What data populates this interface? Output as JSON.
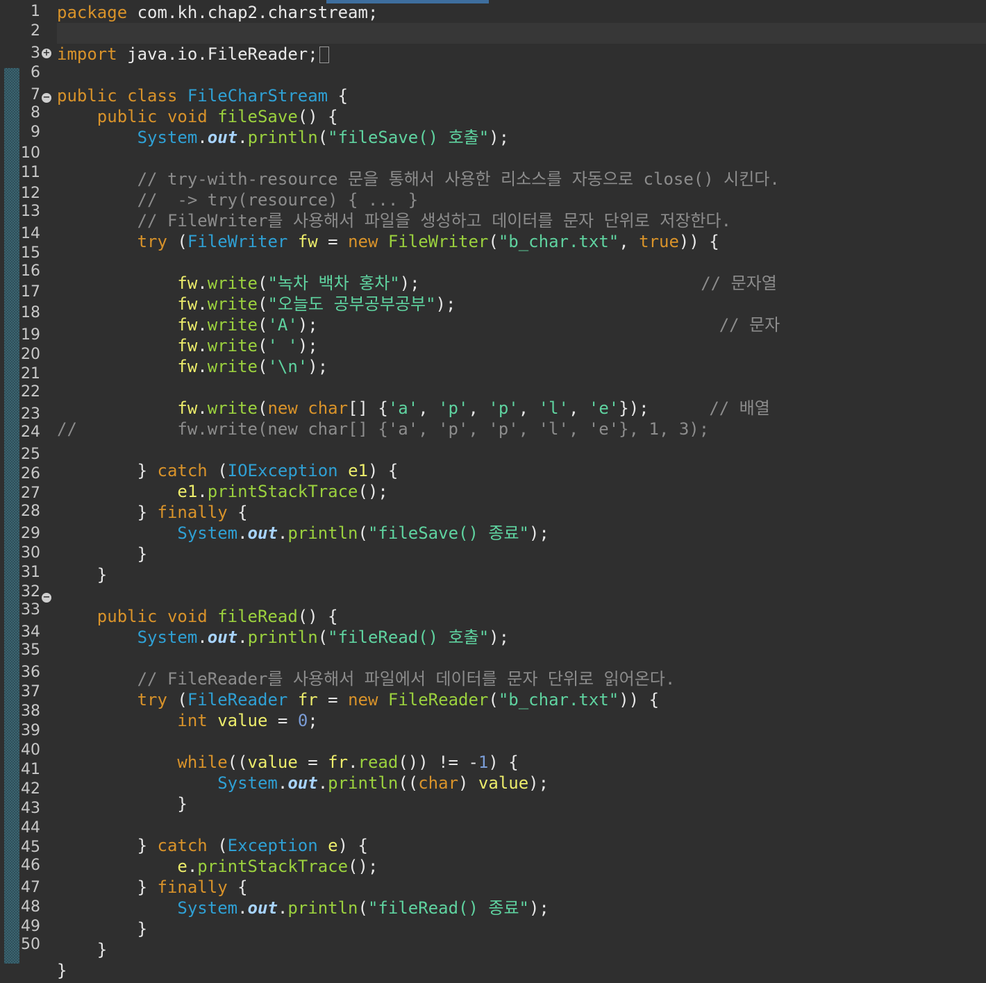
{
  "editor": {
    "line_numbers": [
      "1",
      "2",
      "3",
      "6",
      "7",
      "8",
      "9",
      "10",
      "11",
      "12",
      "13",
      "14",
      "15",
      "16",
      "17",
      "18",
      "19",
      "20",
      "21",
      "22",
      "23",
      "24",
      "25",
      "26",
      "27",
      "28",
      "29",
      "30",
      "31",
      "32",
      "33",
      "34",
      "35",
      "36",
      "37",
      "38",
      "39",
      "40",
      "41",
      "42",
      "43",
      "44",
      "45",
      "46",
      "47",
      "48",
      "49",
      "50"
    ],
    "fold_markers": {
      "import_expand": "+",
      "class_collapse": "−",
      "method_collapse": "−"
    },
    "code": {
      "l1": [
        [
          "kw",
          "package"
        ],
        [
          "pl",
          " com.kh.chap2.charstream;"
        ]
      ],
      "l3": [
        [
          "kw",
          "import"
        ],
        [
          "pl",
          " java.io.FileReader;"
        ]
      ],
      "l7": [
        [
          "kw",
          "public class "
        ],
        [
          "ty",
          "FileCharStream"
        ],
        [
          "pl",
          " {"
        ]
      ],
      "l8": [
        [
          "pl",
          "    "
        ],
        [
          "kw",
          "public void "
        ],
        [
          "fn",
          "fileSave"
        ],
        [
          "pl",
          "() {"
        ]
      ],
      "l9": [
        [
          "pl",
          "        "
        ],
        [
          "ty",
          "System"
        ],
        [
          "pl",
          "."
        ],
        [
          "fld",
          "out"
        ],
        [
          "pl",
          "."
        ],
        [
          "fn",
          "println"
        ],
        [
          "pl",
          "("
        ],
        [
          "st",
          "\"fileSave() 호출\""
        ],
        [
          "pl",
          ");"
        ]
      ],
      "c1": [
        [
          "pl",
          "        "
        ],
        [
          "cm",
          "// try-with-resource 문을 통해서 사용한 리소스를 자동으로 close() 시킨다."
        ]
      ],
      "c2": [
        [
          "pl",
          "        "
        ],
        [
          "cm",
          "//  -> try(resource) { ... }"
        ]
      ],
      "c3": [
        [
          "pl",
          "        "
        ],
        [
          "cm",
          "// FileWriter를 사용해서 파일을 생성하고 데이터를 문자 단위로 저장한다."
        ]
      ],
      "try1": [
        [
          "pl",
          "        "
        ],
        [
          "kw",
          "try"
        ],
        [
          "pl",
          " ("
        ],
        [
          "ty",
          "FileWriter"
        ],
        [
          "pl",
          " "
        ],
        [
          "var",
          "fw"
        ],
        [
          "pl",
          " = "
        ],
        [
          "kw",
          "new "
        ],
        [
          "fn",
          "FileWriter"
        ],
        [
          "pl",
          "("
        ],
        [
          "st",
          "\"b_char.txt\""
        ],
        [
          "pl",
          ", "
        ],
        [
          "kw",
          "true"
        ],
        [
          "pl",
          ")) {"
        ]
      ],
      "w1": [
        [
          "pl",
          "            "
        ],
        [
          "var",
          "fw"
        ],
        [
          "pl",
          "."
        ],
        [
          "fn",
          "write"
        ],
        [
          "pl",
          "("
        ],
        [
          "st",
          "\"녹차 백차 홍차\""
        ],
        [
          "pl",
          ");"
        ],
        [
          "pl",
          "                            "
        ],
        [
          "cm",
          "// 문자열"
        ]
      ],
      "w2": [
        [
          "pl",
          "            "
        ],
        [
          "var",
          "fw"
        ],
        [
          "pl",
          "."
        ],
        [
          "fn",
          "write"
        ],
        [
          "pl",
          "("
        ],
        [
          "st",
          "\"오늘도 공부공부공부\""
        ],
        [
          "pl",
          ");"
        ]
      ],
      "w3": [
        [
          "pl",
          "            "
        ],
        [
          "var",
          "fw"
        ],
        [
          "pl",
          "."
        ],
        [
          "fn",
          "write"
        ],
        [
          "pl",
          "("
        ],
        [
          "st",
          "'A'"
        ],
        [
          "pl",
          ");"
        ],
        [
          "pl",
          "                                        "
        ],
        [
          "cm",
          "// 문자"
        ]
      ],
      "w4": [
        [
          "pl",
          "            "
        ],
        [
          "var",
          "fw"
        ],
        [
          "pl",
          "."
        ],
        [
          "fn",
          "write"
        ],
        [
          "pl",
          "("
        ],
        [
          "st",
          "' '"
        ],
        [
          "pl",
          ");"
        ]
      ],
      "w5": [
        [
          "pl",
          "            "
        ],
        [
          "var",
          "fw"
        ],
        [
          "pl",
          "."
        ],
        [
          "fn",
          "write"
        ],
        [
          "pl",
          "("
        ],
        [
          "st",
          "'\\n'"
        ],
        [
          "pl",
          ");"
        ]
      ],
      "w6": [
        [
          "pl",
          "            "
        ],
        [
          "var",
          "fw"
        ],
        [
          "pl",
          "."
        ],
        [
          "fn",
          "write"
        ],
        [
          "pl",
          "("
        ],
        [
          "kw",
          "new char"
        ],
        [
          "pl",
          "[] {"
        ],
        [
          "st",
          "'a'"
        ],
        [
          "pl",
          ", "
        ],
        [
          "st",
          "'p'"
        ],
        [
          "pl",
          ", "
        ],
        [
          "st",
          "'p'"
        ],
        [
          "pl",
          ", "
        ],
        [
          "st",
          "'l'"
        ],
        [
          "pl",
          ", "
        ],
        [
          "st",
          "'e'"
        ],
        [
          "pl",
          "});      "
        ],
        [
          "cm",
          "// 배열"
        ]
      ],
      "w7": [
        [
          "cm",
          "//          fw.write(new char[] {'a', 'p', 'p', 'l', 'e'}, 1, 3);"
        ]
      ],
      "catch1": [
        [
          "pl",
          "        } "
        ],
        [
          "kw",
          "catch"
        ],
        [
          "pl",
          " ("
        ],
        [
          "ty",
          "IOException"
        ],
        [
          "pl",
          " "
        ],
        [
          "var",
          "e1"
        ],
        [
          "pl",
          ") {"
        ]
      ],
      "pst1": [
        [
          "pl",
          "            "
        ],
        [
          "var",
          "e1"
        ],
        [
          "pl",
          "."
        ],
        [
          "fn",
          "printStackTrace"
        ],
        [
          "pl",
          "();"
        ]
      ],
      "fin1": [
        [
          "pl",
          "        } "
        ],
        [
          "kw",
          "finally"
        ],
        [
          "pl",
          " {"
        ]
      ],
      "end1": [
        [
          "pl",
          "            "
        ],
        [
          "ty",
          "System"
        ],
        [
          "pl",
          "."
        ],
        [
          "fld",
          "out"
        ],
        [
          "pl",
          "."
        ],
        [
          "fn",
          "println"
        ],
        [
          "pl",
          "("
        ],
        [
          "st",
          "\"fileSave() 종료\""
        ],
        [
          "pl",
          ");"
        ]
      ],
      "cb1": [
        [
          "pl",
          "        }"
        ]
      ],
      "cb2": [
        [
          "pl",
          "    }"
        ]
      ],
      "m2": [
        [
          "pl",
          "    "
        ],
        [
          "kw",
          "public void "
        ],
        [
          "fn",
          "fileRead"
        ],
        [
          "pl",
          "() {"
        ]
      ],
      "m2p": [
        [
          "pl",
          "        "
        ],
        [
          "ty",
          "System"
        ],
        [
          "pl",
          "."
        ],
        [
          "fld",
          "out"
        ],
        [
          "pl",
          "."
        ],
        [
          "fn",
          "println"
        ],
        [
          "pl",
          "("
        ],
        [
          "st",
          "\"fileRead() 호출\""
        ],
        [
          "pl",
          ");"
        ]
      ],
      "c4": [
        [
          "pl",
          "        "
        ],
        [
          "cm",
          "// FileReader를 사용해서 파일에서 데이터를 문자 단위로 읽어온다."
        ]
      ],
      "try2": [
        [
          "pl",
          "        "
        ],
        [
          "kw",
          "try"
        ],
        [
          "pl",
          " ("
        ],
        [
          "ty",
          "FileReader"
        ],
        [
          "pl",
          " "
        ],
        [
          "var",
          "fr"
        ],
        [
          "pl",
          " = "
        ],
        [
          "kw",
          "new "
        ],
        [
          "fn",
          "FileReader"
        ],
        [
          "pl",
          "("
        ],
        [
          "st",
          "\"b_char.txt\""
        ],
        [
          "pl",
          ")) {"
        ]
      ],
      "intv": [
        [
          "pl",
          "            "
        ],
        [
          "kw",
          "int"
        ],
        [
          "pl",
          " "
        ],
        [
          "var",
          "value"
        ],
        [
          "pl",
          " = "
        ],
        [
          "num",
          "0"
        ],
        [
          "pl",
          ";"
        ]
      ],
      "wh": [
        [
          "pl",
          "            "
        ],
        [
          "kw",
          "while"
        ],
        [
          "pl",
          "(("
        ],
        [
          "var",
          "value"
        ],
        [
          "pl",
          " = "
        ],
        [
          "var",
          "fr"
        ],
        [
          "pl",
          "."
        ],
        [
          "fn",
          "read"
        ],
        [
          "pl",
          "()) != -"
        ],
        [
          "num",
          "1"
        ],
        [
          "pl",
          ") {"
        ]
      ],
      "whp": [
        [
          "pl",
          "                "
        ],
        [
          "ty",
          "System"
        ],
        [
          "pl",
          "."
        ],
        [
          "fld",
          "out"
        ],
        [
          "pl",
          "."
        ],
        [
          "fn",
          "println"
        ],
        [
          "pl",
          "(("
        ],
        [
          "kw",
          "char"
        ],
        [
          "pl",
          ") "
        ],
        [
          "var",
          "value"
        ],
        [
          "pl",
          ");"
        ]
      ],
      "whc": [
        [
          "pl",
          "            }"
        ]
      ],
      "catch2": [
        [
          "pl",
          "        } "
        ],
        [
          "kw",
          "catch"
        ],
        [
          "pl",
          " ("
        ],
        [
          "ty",
          "Exception"
        ],
        [
          "pl",
          " "
        ],
        [
          "var",
          "e"
        ],
        [
          "pl",
          ") {"
        ]
      ],
      "pst2": [
        [
          "pl",
          "            "
        ],
        [
          "var",
          "e"
        ],
        [
          "pl",
          "."
        ],
        [
          "fn",
          "printStackTrace"
        ],
        [
          "pl",
          "();"
        ]
      ],
      "fin2": [
        [
          "pl",
          "        } "
        ],
        [
          "kw",
          "finally"
        ],
        [
          "pl",
          " {"
        ]
      ],
      "end2": [
        [
          "pl",
          "            "
        ],
        [
          "ty",
          "System"
        ],
        [
          "pl",
          "."
        ],
        [
          "fld",
          "out"
        ],
        [
          "pl",
          "."
        ],
        [
          "fn",
          "println"
        ],
        [
          "pl",
          "("
        ],
        [
          "st",
          "\"fileRead() 종료\""
        ],
        [
          "pl",
          ");"
        ]
      ],
      "cb3": [
        [
          "pl",
          "        }"
        ]
      ],
      "cb4": [
        [
          "pl",
          "    }"
        ]
      ],
      "cb5": [
        [
          "pl",
          "}"
        ]
      ]
    }
  }
}
